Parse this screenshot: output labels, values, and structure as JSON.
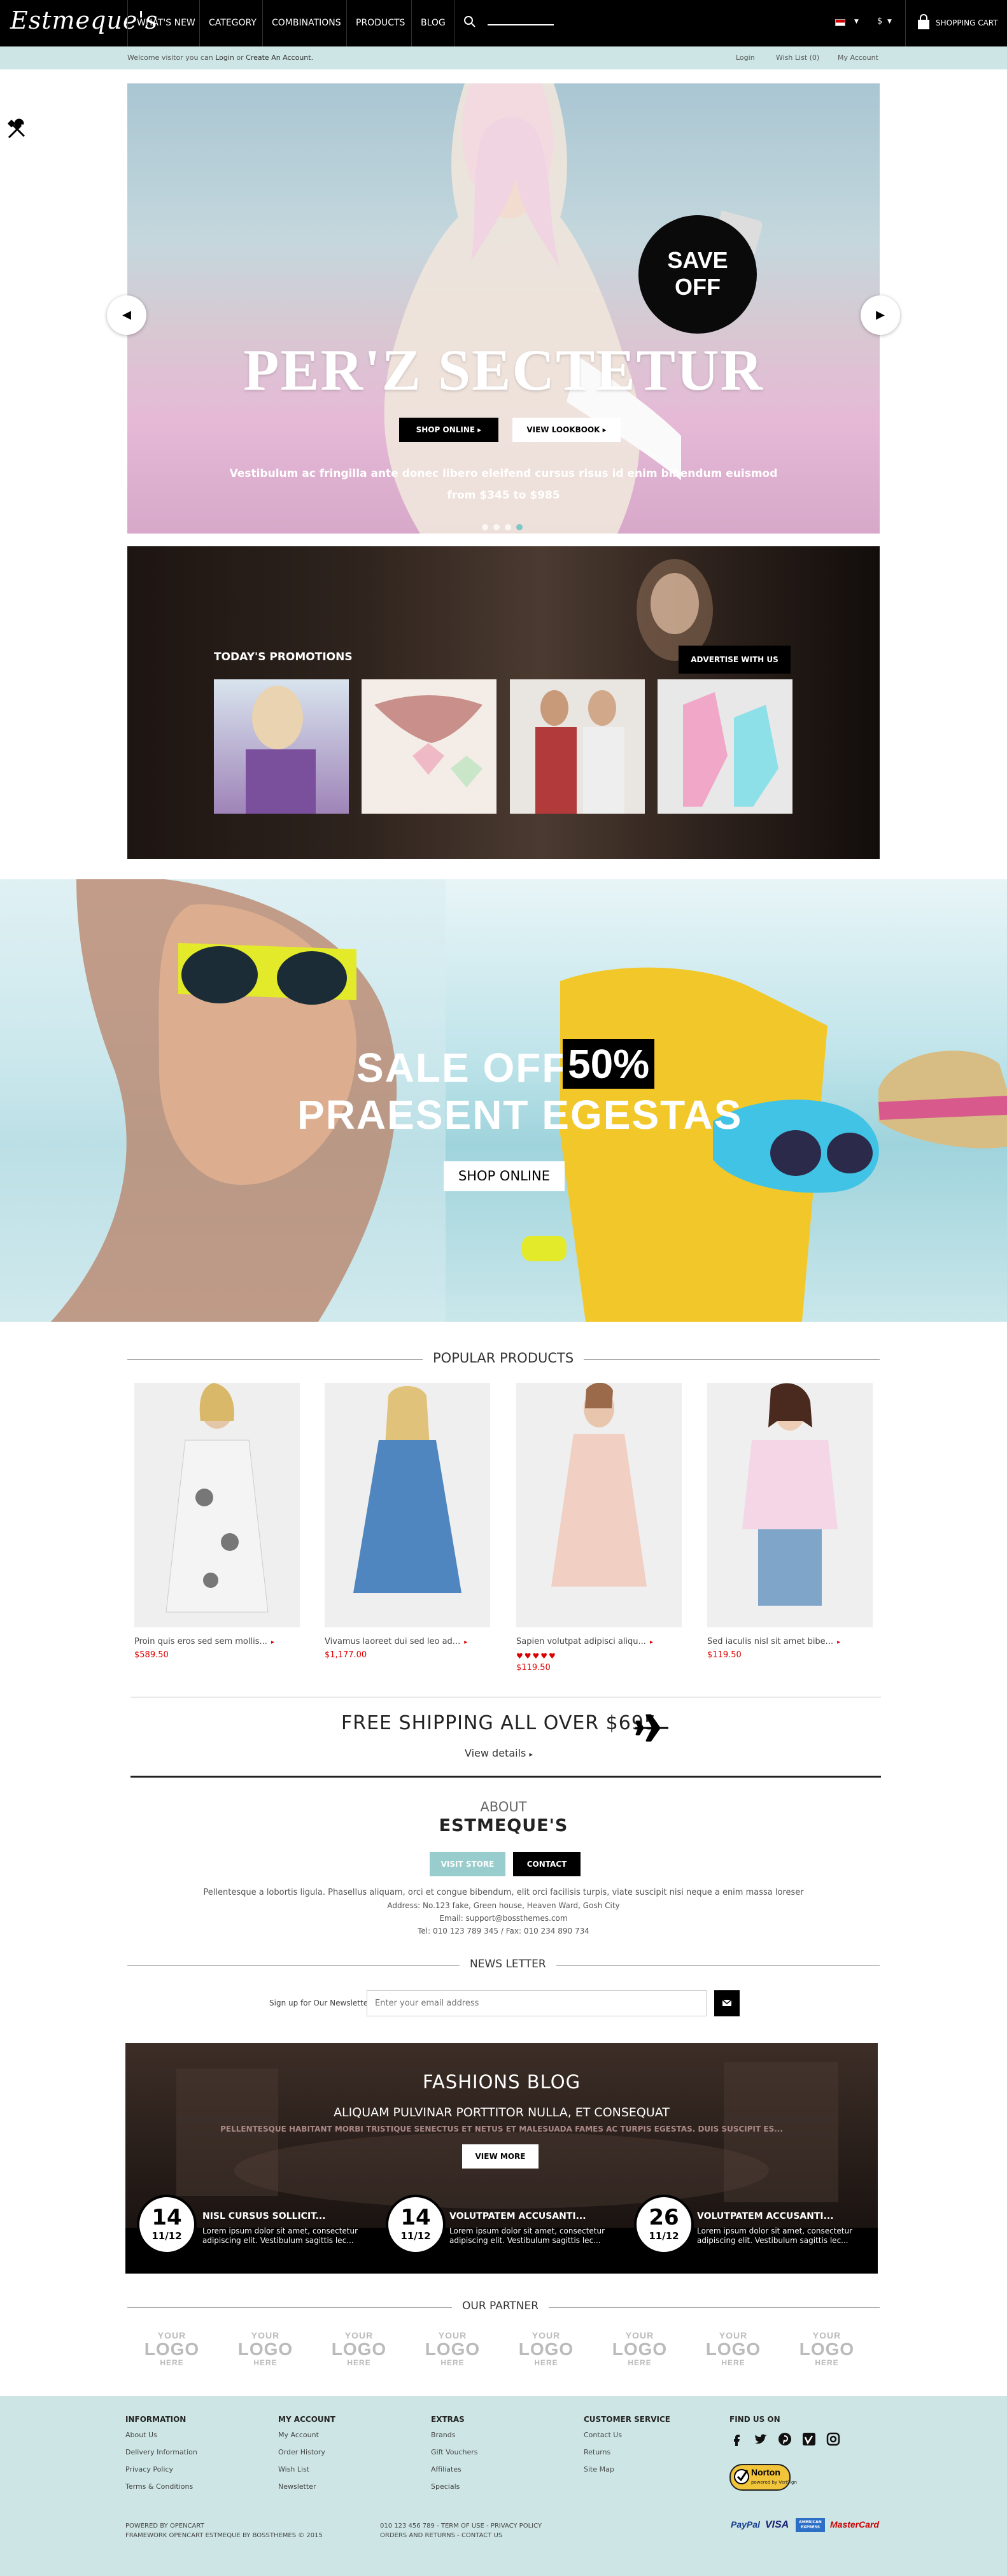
{
  "header": {
    "logo": "Estmeque's",
    "nav": [
      "WHAT'S NEW",
      "CATEGORY",
      "COMBINATIONS",
      "PRODUCTS",
      "BLOG"
    ],
    "currency": "$",
    "cart_label": "SHOPPING CART"
  },
  "infobar": {
    "welcome_prefix": "Welcome visitor you can ",
    "login_link": "Login",
    "or": " or ",
    "create_link": "Create An Account.",
    "right_links": [
      "Login",
      "Wish List (0)",
      "My Account"
    ]
  },
  "hero": {
    "badge_line1": "SAVE",
    "badge_line2": "OFF",
    "headline": "PER'Z SECTETUR",
    "btn_shop": "SHOP ONLINE",
    "btn_lookbook": "VIEW LOOKBOOK",
    "sub_line1": "Vestibulum ac fringilla ante donec libero eleifend cursus risus id enim bibendum euismod",
    "sub_line2": "from $345 to $985",
    "dots": 4,
    "active_dot": 3
  },
  "promotions": {
    "title": "TODAY'S PROMOTIONS",
    "advertise": "ADVERTISE WITH US"
  },
  "sale_banner": {
    "line1": "SALE OFF",
    "pct": "50%",
    "line2": "PRAESENT EGESTAS",
    "button": "SHOP ONLINE"
  },
  "popular": {
    "title": "POPULAR PRODUCTS",
    "products": [
      {
        "name": "Proin quis eros sed sem mollis...",
        "price": "$589.50"
      },
      {
        "name": "Vivamus laoreet dui sed leo ad...",
        "price": "$1,177.00"
      },
      {
        "name": "Sapien volutpat adipisci aliqu...",
        "price": "$119.50",
        "stars": 5
      },
      {
        "name": "Sed iaculis nisl sit amet bibe...",
        "price": "$119.50"
      }
    ]
  },
  "shipping": {
    "title": "FREE SHIPPING ALL OVER $695",
    "link": "View details"
  },
  "about": {
    "small": "ABOUT",
    "big": "ESTMEQUE'S",
    "visit_btn": "VISIT STORE",
    "contact_btn": "CONTACT",
    "text": "Pellentesque a lobortis ligula. Phasellus aliquam, orci et congue bibendum, elit orci facilisis turpis, viate suscipit nisi neque a enim massa loreser",
    "address": "Address: No.123 fake, Green house, Heaven Ward, Gosh City",
    "email": "Email: support@bossthemes.com",
    "phone": "Tel: 010 123 789 345 / Fax: 010 234 890 734"
  },
  "newsletter": {
    "title": "NEWS LETTER",
    "label": "Sign up for Our Newsletter",
    "placeholder": "Enter your email address"
  },
  "blog": {
    "title": "FASHIONS BLOG",
    "subtitle": "ALIQUAM PULVINAR PORTTITOR NULLA, ET CONSEQUAT",
    "desc": "PELLENTESQUE HABITANT MORBI TRISTIQUE SENECTUS ET NETUS ET MALESUADA FAMES AC TURPIS EGESTAS. DUIS SUSCIPIT ES...",
    "button": "VIEW MORE",
    "posts": [
      {
        "day": "14",
        "month": "11/12",
        "title": "NISL CURSUS SOLLICIT...",
        "text": "Lorem ipsum dolor sit amet, consectetur adipiscing elit. Vestibulum sagittis lec..."
      },
      {
        "day": "14",
        "month": "11/12",
        "title": "VOLUTPATEM ACCUSANTI...",
        "text": "Lorem ipsum dolor sit amet, consectetur adipiscing elit. Vestibulum sagittis lec..."
      },
      {
        "day": "26",
        "month": "11/12",
        "title": "VOLUTPATEM ACCUSANTI...",
        "text": "Lorem ipsum dolor sit amet, consectetur adipiscing elit. Vestibulum sagittis lec..."
      }
    ]
  },
  "partners": {
    "title": "OUR PARTNER",
    "logo_line1": "YOUR",
    "logo_line2": "LOGO",
    "logo_line3": "HERE",
    "count": 8
  },
  "footer": {
    "columns": [
      {
        "title": "INFORMATION",
        "links": [
          "About Us",
          "Delivery Information",
          "Privacy Policy",
          "Terms & Conditions"
        ]
      },
      {
        "title": "MY ACCOUNT",
        "links": [
          "My Account",
          "Order History",
          "Wish List",
          "Newsletter"
        ]
      },
      {
        "title": "EXTRAS",
        "links": [
          "Brands",
          "Gift Vouchers",
          "Affiliates",
          "Specials"
        ]
      },
      {
        "title": "CUSTOMER SERVICE",
        "links": [
          "Contact Us",
          "Returns",
          "Site Map"
        ]
      }
    ],
    "find_us": "FIND US ON",
    "norton": "Norton",
    "norton_sub": "powered by VeriSign",
    "powered_1": "POWERED BY OPENCART",
    "powered_2": "FRAMEWORK OPENCART ESTMEQUE BY BOSSTHEMES © 2015",
    "contact_1": "010 123 456 789 - TERM OF USE - PRIVACY POLICY",
    "contact_2": "ORDERS AND RETURNS - CONTACT US",
    "payments": [
      "PayPal",
      "VISA",
      "AMERICAN EXPRESS",
      "MasterCard"
    ]
  },
  "colors": {
    "infobar_bg": "#cde6e5",
    "footer_bg": "#cde6e5",
    "accent_red": "#dd0000",
    "visit_btn": "#99cccc"
  }
}
